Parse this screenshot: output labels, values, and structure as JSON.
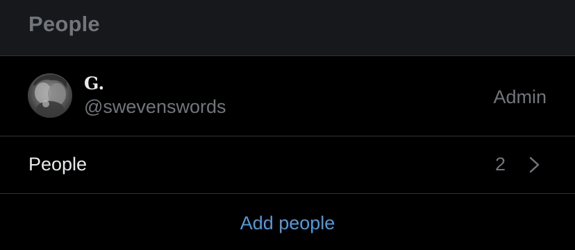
{
  "header": {
    "title": "People"
  },
  "member": {
    "avatar_icon": "user-avatar-photo",
    "name": "G.",
    "handle": "@swevenswords",
    "role": "Admin"
  },
  "people_row": {
    "label": "People",
    "count": "2",
    "chevron_icon": "chevron-right-icon"
  },
  "actions": {
    "add_people_label": "Add people"
  },
  "colors": {
    "background": "#000000",
    "header_background": "#16181c",
    "divider": "#2f3336",
    "primary_text": "#e7e9ea",
    "secondary_text": "#71767b",
    "accent": "#4a9be0"
  }
}
